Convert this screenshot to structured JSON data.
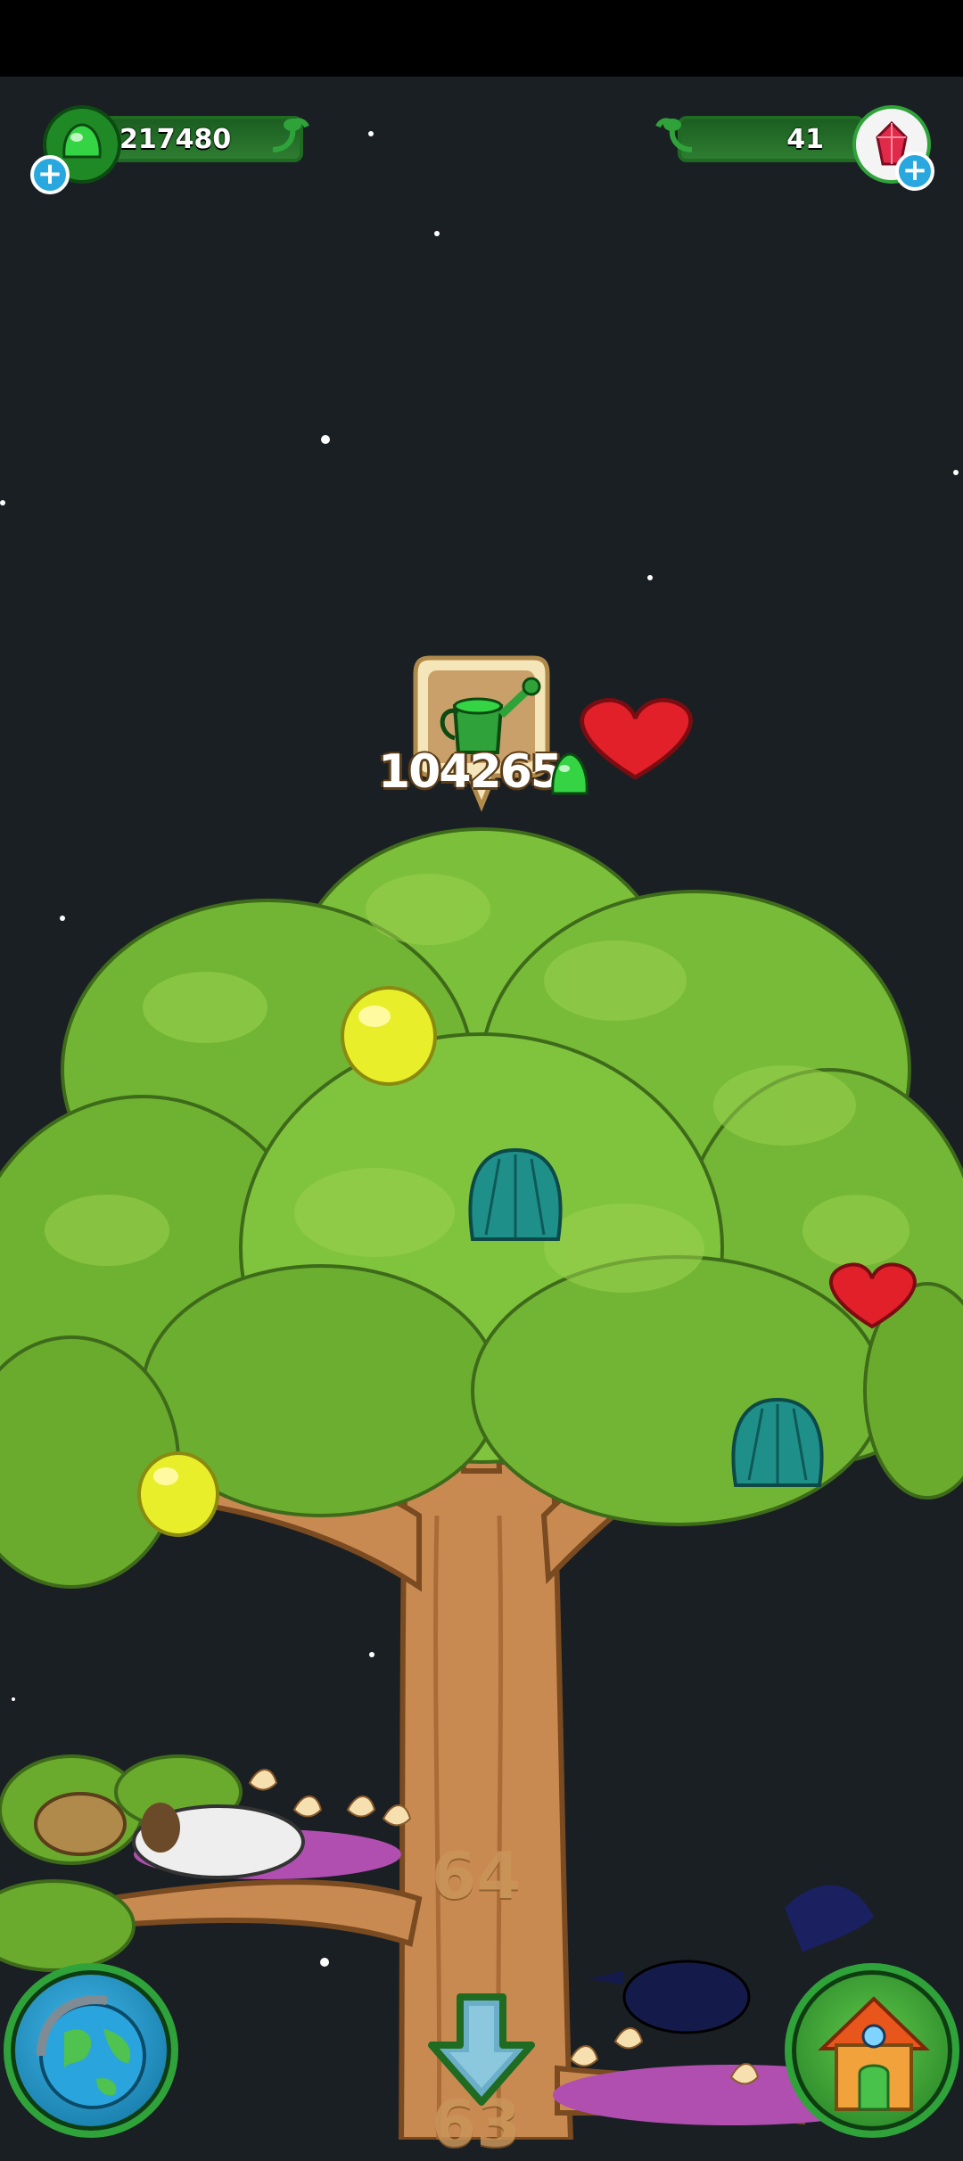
{
  "hud": {
    "green_gems": "217480",
    "red_gems": "41"
  },
  "tree": {
    "water_amount": "104265",
    "level_current": "64",
    "level_below": "63"
  },
  "icons": {
    "left_resource": "green-gem-icon",
    "right_resource": "red-crystal-icon",
    "water": "watering-can-icon",
    "world": "globe-icon",
    "home": "house-icon",
    "down": "down-arrow-icon"
  },
  "colors": {
    "background": "#1a1f24",
    "leaf": "#7cbf3a",
    "trunk": "#c98a52",
    "accent_green": "#2fa33a",
    "plus_blue": "#29a8e0"
  }
}
